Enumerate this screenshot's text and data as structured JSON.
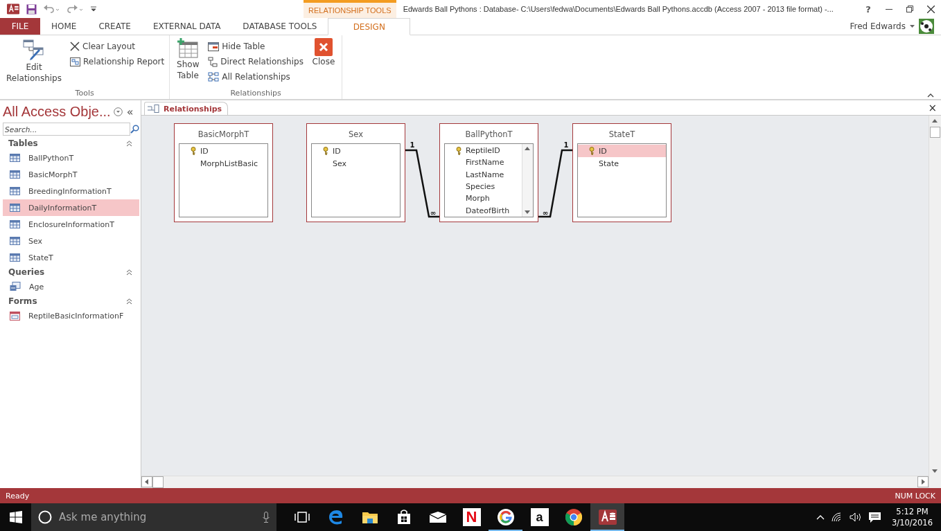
{
  "title_bar": {
    "context_tab": "RELATIONSHIP TOOLS",
    "title": "Edwards Ball Pythons : Database- C:\\Users\\fedwa\\Documents\\Edwards Ball Pythons.accdb (Access 2007 - 2013 file format) -...",
    "help": "?"
  },
  "ribbon_tabs": [
    {
      "label": "FILE",
      "kind": "file",
      "selected": false
    },
    {
      "label": "HOME",
      "kind": "tab",
      "selected": false
    },
    {
      "label": "CREATE",
      "kind": "tab",
      "selected": false
    },
    {
      "label": "EXTERNAL DATA",
      "kind": "tab",
      "selected": false
    },
    {
      "label": "DATABASE TOOLS",
      "kind": "tab",
      "selected": false
    },
    {
      "label": "DESIGN",
      "kind": "tab",
      "selected": true
    }
  ],
  "user": "Fred Edwards",
  "ribbon_groups": [
    {
      "label": "Tools",
      "commands": [
        {
          "label": "Edit Relationships",
          "kind": "large"
        },
        {
          "label": "Clear Layout",
          "kind": "small"
        },
        {
          "label": "Relationship Report",
          "kind": "small"
        }
      ]
    },
    {
      "label": "Relationships",
      "commands": [
        {
          "label": "Show Table",
          "kind": "large"
        },
        {
          "label": "Hide Table",
          "kind": "small"
        },
        {
          "label": "Direct Relationships",
          "kind": "small"
        },
        {
          "label": "All Relationships",
          "kind": "small"
        },
        {
          "label": "Close",
          "kind": "large"
        }
      ]
    }
  ],
  "nav": {
    "title": "All Access Obje...",
    "collapse": "«",
    "search": {
      "placeholder": "Search..."
    },
    "groups": [
      {
        "label": "Tables",
        "kind": "table",
        "items": [
          {
            "label": "BallPythonT",
            "selected": false
          },
          {
            "label": "BasicMorphT",
            "selected": false
          },
          {
            "label": "BreedingInformationT",
            "selected": false
          },
          {
            "label": "DailyInformationT",
            "selected": true
          },
          {
            "label": "EnclosureInformationT",
            "selected": false
          },
          {
            "label": "Sex",
            "selected": false
          },
          {
            "label": "StateT",
            "selected": false
          }
        ]
      },
      {
        "label": "Queries",
        "kind": "query",
        "items": [
          {
            "label": "Age",
            "selected": false
          }
        ]
      },
      {
        "label": "Forms",
        "kind": "form",
        "items": [
          {
            "label": "ReptileBasicInformationF",
            "selected": false
          }
        ]
      }
    ]
  },
  "document_tab": {
    "label": "Relationships",
    "close": "×"
  },
  "tables": [
    {
      "name": "BasicMorphT",
      "scrollbar": false,
      "fields": [
        {
          "name": "ID",
          "primary_key": true,
          "selected": false
        },
        {
          "name": "MorphListBasic",
          "primary_key": false,
          "selected": false
        }
      ]
    },
    {
      "name": "Sex",
      "scrollbar": false,
      "fields": [
        {
          "name": "ID",
          "primary_key": true,
          "selected": false
        },
        {
          "name": "Sex",
          "primary_key": false,
          "selected": false
        }
      ]
    },
    {
      "name": "BallPythonT",
      "scrollbar": true,
      "fields": [
        {
          "name": "ReptileID",
          "primary_key": true,
          "selected": false
        },
        {
          "name": "FirstName",
          "primary_key": false,
          "selected": false
        },
        {
          "name": "LastName",
          "primary_key": false,
          "selected": false
        },
        {
          "name": "Species",
          "primary_key": false,
          "selected": false
        },
        {
          "name": "Morph",
          "primary_key": false,
          "selected": false
        },
        {
          "name": "DateofBirth",
          "primary_key": false,
          "selected": false
        }
      ]
    },
    {
      "name": "StateT",
      "scrollbar": false,
      "fields": [
        {
          "name": "ID",
          "primary_key": true,
          "selected": true
        },
        {
          "name": "State",
          "primary_key": false,
          "selected": false
        }
      ]
    }
  ],
  "relationships": [
    {
      "one_label": "1",
      "many_label": "∞"
    },
    {
      "one_label": "1",
      "many_label": "∞"
    }
  ],
  "status_bar": {
    "left": "Ready",
    "right": "NUM LOCK"
  },
  "taskbar": {
    "search": {
      "placeholder": "Ask me anything"
    },
    "apps": [
      {
        "kind": "taskview",
        "running": false,
        "active": false
      },
      {
        "kind": "edge",
        "running": false,
        "active": false
      },
      {
        "kind": "explorer",
        "running": false,
        "active": false
      },
      {
        "kind": "store",
        "running": false,
        "active": false
      },
      {
        "kind": "mail",
        "running": false,
        "active": false
      },
      {
        "kind": "netflix",
        "glyph": "N",
        "running": false,
        "active": false
      },
      {
        "kind": "google",
        "running": true,
        "active": false
      },
      {
        "kind": "amazon",
        "glyph": "a",
        "running": false,
        "active": false
      },
      {
        "kind": "chrome",
        "running": false,
        "active": false
      },
      {
        "kind": "access",
        "running": true,
        "active": true
      }
    ],
    "time": "5:12 PM",
    "date": "3/10/2016"
  }
}
